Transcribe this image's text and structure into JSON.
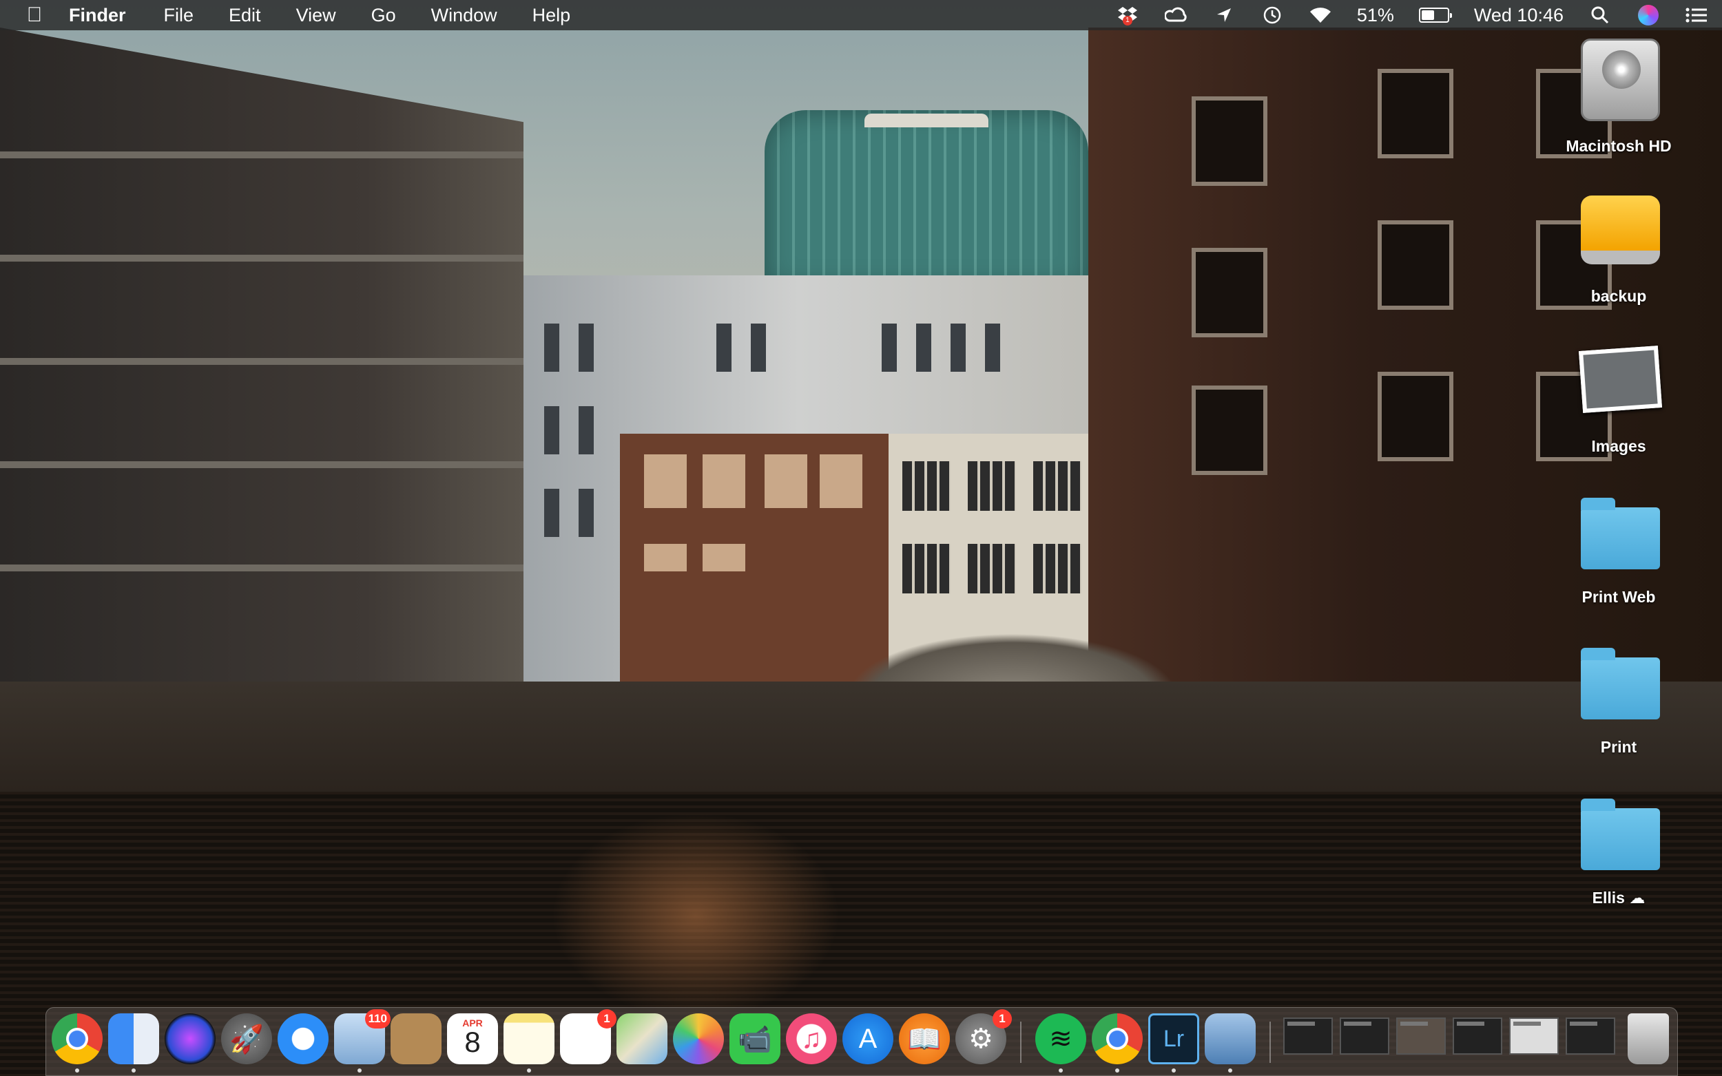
{
  "menubar": {
    "apple_icon": "apple-logo",
    "app_name": "Finder",
    "menus": [
      "File",
      "Edit",
      "View",
      "Go",
      "Window",
      "Help"
    ],
    "status": {
      "dropbox_badge": "1",
      "battery_percent": "51%",
      "battery_level": 0.51,
      "clock": "Wed 10:46"
    }
  },
  "desktop_icons": [
    {
      "label": "Macintosh HD",
      "icon": "hard-drive-icon"
    },
    {
      "label": "backup",
      "icon": "external-drive-icon"
    },
    {
      "label": "Images",
      "icon": "photos-stack-icon"
    },
    {
      "label": "Print Web",
      "icon": "folder-icon"
    },
    {
      "label": "Print",
      "icon": "folder-icon"
    },
    {
      "label": "Ellis",
      "icon": "folder-icon",
      "cloud_glyph": "☁"
    }
  ],
  "dock": {
    "apps": [
      {
        "name": "chrome-app",
        "icon": "chrome-icon"
      },
      {
        "name": "finder-app",
        "icon": "finder-icon"
      },
      {
        "name": "siri-app",
        "icon": "siri-icon"
      },
      {
        "name": "launchpad-app",
        "icon": "rocket-icon"
      },
      {
        "name": "safari-app",
        "icon": "compass-icon"
      },
      {
        "name": "mail-app",
        "icon": "mail-icon",
        "badge": "110"
      },
      {
        "name": "contacts-app",
        "icon": "contacts-icon"
      },
      {
        "name": "calendar-app",
        "icon": "calendar-icon",
        "month": "APR",
        "day": "8"
      },
      {
        "name": "notes-app",
        "icon": "notes-icon"
      },
      {
        "name": "reminders-app",
        "icon": "reminders-icon",
        "badge": "1"
      },
      {
        "name": "maps-app",
        "icon": "maps-icon"
      },
      {
        "name": "photos-app",
        "icon": "photos-icon"
      },
      {
        "name": "facetime-app",
        "icon": "facetime-icon"
      },
      {
        "name": "itunes-app",
        "icon": "music-note-icon"
      },
      {
        "name": "app-store-app",
        "icon": "app-store-icon"
      },
      {
        "name": "books-app",
        "icon": "book-icon"
      },
      {
        "name": "system-preferences-app",
        "icon": "gear-icon",
        "badge": "1"
      },
      {
        "name": "spotify-app",
        "icon": "spotify-icon"
      },
      {
        "name": "chrome-app-2",
        "icon": "chrome-icon"
      },
      {
        "name": "lightroom-app",
        "icon": "lightroom-icon",
        "text": "Lr"
      },
      {
        "name": "preview-app",
        "icon": "preview-icon"
      }
    ],
    "minimized_windows": 6,
    "trash_icon": "trash-icon"
  }
}
